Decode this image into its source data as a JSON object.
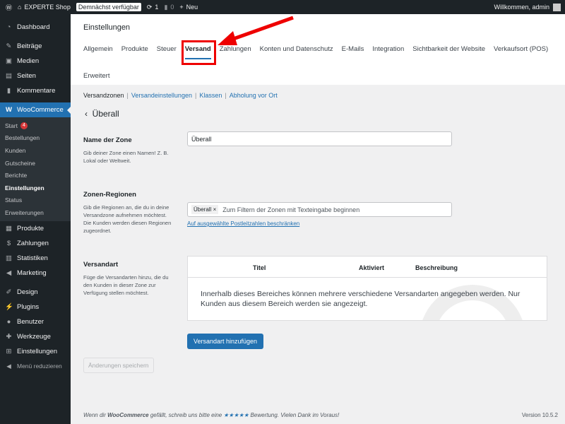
{
  "adminbar": {
    "site": "EXPERTE Shop",
    "soon": "Demnächst verfügbar",
    "updates": "1",
    "comments": "0",
    "new": "Neu",
    "welcome": "Willkommen, admin"
  },
  "sidebar": {
    "items": [
      "Dashboard",
      "Beiträge",
      "Medien",
      "Seiten",
      "Kommentare",
      "WooCommerce"
    ],
    "sub": [
      "Start",
      "Bestellungen",
      "Kunden",
      "Gutscheine",
      "Berichte",
      "Einstellungen",
      "Status",
      "Erweiterungen"
    ],
    "start_count": "4",
    "items2": [
      "Produkte",
      "Zahlungen",
      "Statistiken",
      "Marketing"
    ],
    "items3": [
      "Design",
      "Plugins",
      "Benutzer",
      "Werkzeuge",
      "Einstellungen",
      "Menü reduzieren"
    ]
  },
  "header": {
    "title": "Einstellungen",
    "tabs": [
      "Allgemein",
      "Produkte",
      "Steuer",
      "Versand",
      "Zahlungen",
      "Konten und Datenschutz",
      "E-Mails",
      "Integration",
      "Sichtbarkeit der Website",
      "Verkaufsort (POS)",
      "Erweitert"
    ]
  },
  "subnav": [
    "Versandzonen",
    "Versandeinstellungen",
    "Klassen",
    "Abholung vor Ort"
  ],
  "zone": {
    "back_title": "Überall",
    "name_label": "Name der Zone",
    "name_desc": "Gib deiner Zone einen Namen! Z. B. Lokal oder Weltweit.",
    "name_value": "Überall",
    "regions_label": "Zonen-Regionen",
    "regions_desc": "Gib die Regionen an, die du in deine Versandzone aufnehmen möchtest. Die Kunden werden diesen Regionen zugeordnet.",
    "region_chip": "Überall",
    "regions_placeholder": "Zum Filtern der Zonen mit Texteingabe beginnen",
    "postcode_link": "Auf ausgewählte Postleitzahlen beschränken",
    "methods_label": "Versandart",
    "methods_desc": "Füge die Versandarten hinzu, die du den Kunden in dieser Zone zur Verfügung stellen möchtest.",
    "cols": [
      "Titel",
      "Aktiviert",
      "Beschreibung"
    ],
    "empty": "Innerhalb dieses Bereiches können mehrere verschiedene Versandarten angegeben werden. Nur Kunden aus diesem Bereich werden sie angezeigt.",
    "add_button": "Versandart hinzufügen",
    "save_button": "Änderungen speichern"
  },
  "footer": {
    "pre": "Wenn dir ",
    "brand": "WooCommerce",
    "mid": " gefällt, schreib uns bitte eine ",
    "stars": "★★★★★",
    "post": " Bewertung. Vielen Dank im Voraus!",
    "version": "Version 10.5.2"
  }
}
